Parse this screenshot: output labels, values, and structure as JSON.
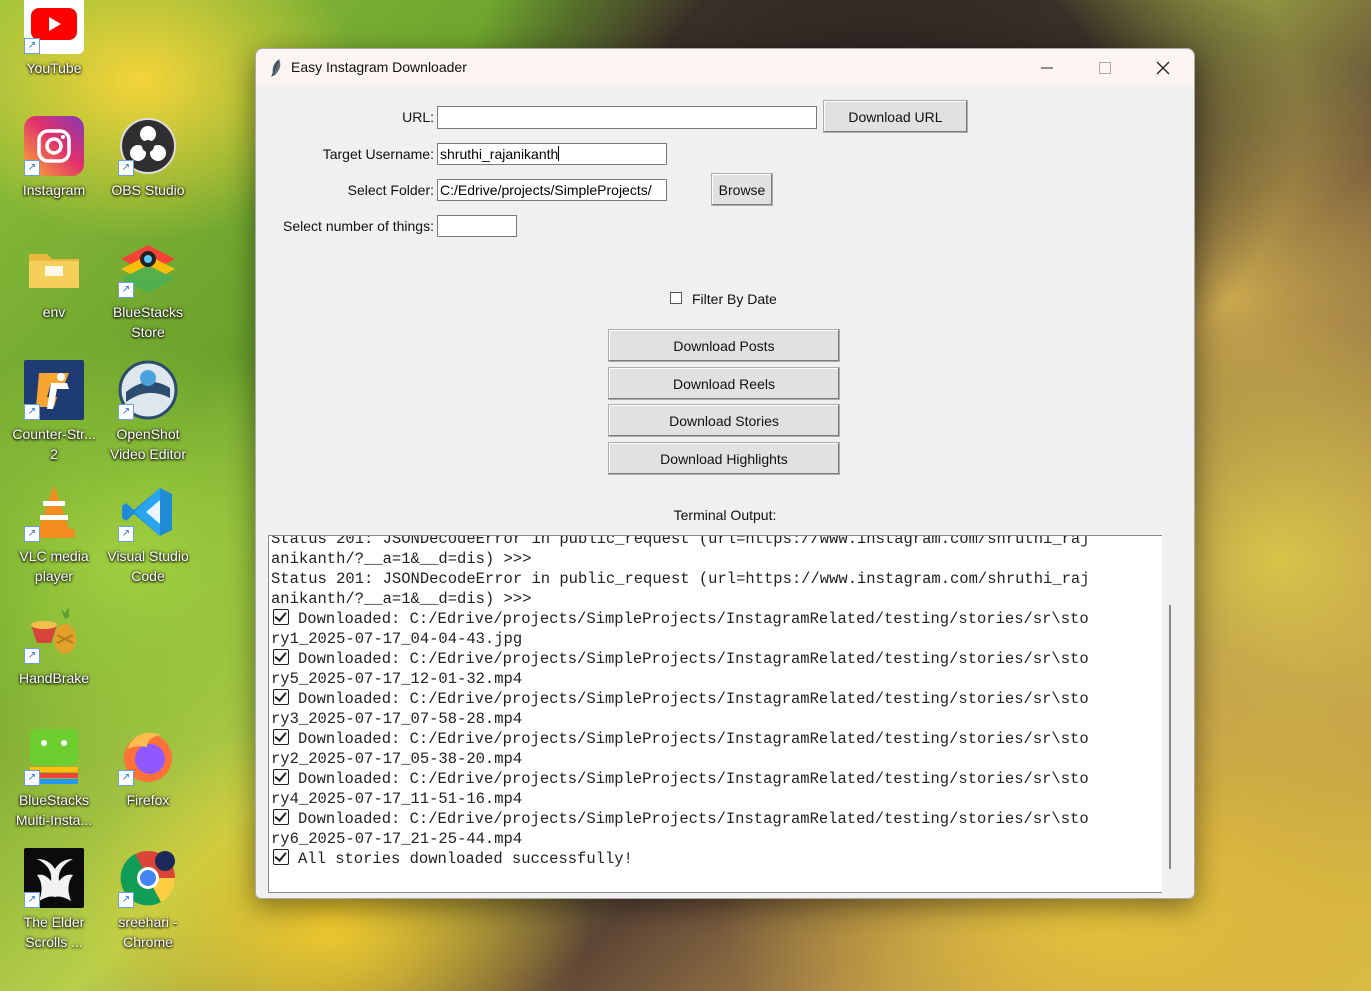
{
  "desktop": {
    "icons": [
      {
        "label": "YouTube",
        "icon": "youtube-icon"
      },
      {
        "label": "Instagram",
        "icon": "instagram-icon"
      },
      {
        "label": "OBS Studio",
        "icon": "obs-icon"
      },
      {
        "label": "env",
        "icon": "folder-icon"
      },
      {
        "label": "BlueStacks Store",
        "icon": "bluestacks-store-icon"
      },
      {
        "label": "Counter-Str... 2",
        "icon": "counter-strike-icon"
      },
      {
        "label": "OpenShot Video Editor",
        "icon": "openshot-icon"
      },
      {
        "label": "VLC media player",
        "icon": "vlc-icon"
      },
      {
        "label": "Visual Studio Code",
        "icon": "vscode-icon"
      },
      {
        "label": "HandBrake",
        "icon": "handbrake-icon"
      },
      {
        "label": "BlueStacks Multi-Insta...",
        "icon": "bluestacks-multi-icon"
      },
      {
        "label": "Firefox",
        "icon": "firefox-icon"
      },
      {
        "label": "The Elder Scrolls ...",
        "icon": "elder-scrolls-icon"
      },
      {
        "label": "sreehari - Chrome",
        "icon": "chrome-icon"
      }
    ]
  },
  "window": {
    "title": "Easy Instagram Downloader",
    "controls": {
      "minimize": "—",
      "maximize": "☐",
      "close": "✕"
    }
  },
  "form": {
    "url_label": "URL:",
    "url_value": "",
    "download_url_button": "Download URL",
    "username_label": "Target Username:",
    "username_value": "shruthi_rajanikanth",
    "folder_label": "Select Folder:",
    "folder_value": "C:/Edrive/projects/SimpleProjects/",
    "browse_button": "Browse",
    "count_label": "Select number of things:",
    "count_value": "",
    "filter_label": "Filter By Date",
    "filter_checked": false
  },
  "actions": {
    "posts": "Download Posts",
    "reels": "Download Reels",
    "stories": "Download Stories",
    "highlights": "Download Highlights"
  },
  "terminal": {
    "label": "Terminal Output:",
    "lines": [
      {
        "check": false,
        "text": "Status 201: JSONDecodeError in public_request (url=https://www.instagram.com/shruthi_raj"
      },
      {
        "check": false,
        "text": "anikanth/?__a=1&__d=dis) >>>"
      },
      {
        "check": false,
        "text": "Status 201: JSONDecodeError in public_request (url=https://www.instagram.com/shruthi_raj"
      },
      {
        "check": false,
        "text": "anikanth/?__a=1&__d=dis) >>>"
      },
      {
        "check": true,
        "text": "Downloaded: C:/Edrive/projects/SimpleProjects/InstagramRelated/testing/stories/sr\\sto"
      },
      {
        "check": false,
        "text": "ry1_2025-07-17_04-04-43.jpg"
      },
      {
        "check": true,
        "text": "Downloaded: C:/Edrive/projects/SimpleProjects/InstagramRelated/testing/stories/sr\\sto"
      },
      {
        "check": false,
        "text": "ry5_2025-07-17_12-01-32.mp4"
      },
      {
        "check": true,
        "text": "Downloaded: C:/Edrive/projects/SimpleProjects/InstagramRelated/testing/stories/sr\\sto"
      },
      {
        "check": false,
        "text": "ry3_2025-07-17_07-58-28.mp4"
      },
      {
        "check": true,
        "text": "Downloaded: C:/Edrive/projects/SimpleProjects/InstagramRelated/testing/stories/sr\\sto"
      },
      {
        "check": false,
        "text": "ry2_2025-07-17_05-38-20.mp4"
      },
      {
        "check": true,
        "text": "Downloaded: C:/Edrive/projects/SimpleProjects/InstagramRelated/testing/stories/sr\\sto"
      },
      {
        "check": false,
        "text": "ry4_2025-07-17_11-51-16.mp4"
      },
      {
        "check": true,
        "text": "Downloaded: C:/Edrive/projects/SimpleProjects/InstagramRelated/testing/stories/sr\\sto"
      },
      {
        "check": false,
        "text": "ry6_2025-07-17_21-25-44.mp4"
      },
      {
        "check": true,
        "text": "All stories downloaded successfully!"
      }
    ]
  }
}
